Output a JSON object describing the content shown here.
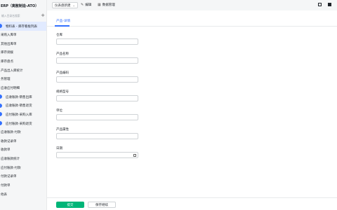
{
  "app": {
    "title": "ERP（离散制造-ATO）"
  },
  "search": {
    "placeholder": "输入目录名搜索"
  },
  "sidebar": {
    "items": [
      {
        "label": "物料表 - 库存看板列表",
        "level": 1,
        "active": true,
        "dot": true
      },
      {
        "label": "采购入库单",
        "level": 0
      },
      {
        "label": "其他出库单",
        "level": 0
      },
      {
        "label": "库存调拨",
        "level": 0
      },
      {
        "label": "库存盘点",
        "level": 0
      },
      {
        "label": "产品出入库统计",
        "level": 0
      },
      {
        "label": "务管理",
        "level": 0
      },
      {
        "label": "应收应付明细",
        "level": 0
      },
      {
        "label": "应收账款-销售出库",
        "level": 1,
        "dot": true
      },
      {
        "label": "应收账款-销售退货",
        "level": 1,
        "dot": true
      },
      {
        "label": "应付账款-采购入库",
        "level": 1,
        "dot": true
      },
      {
        "label": "应付账款-采购退货",
        "level": 1,
        "dot": true
      },
      {
        "label": "应收账款-付款",
        "level": 0
      },
      {
        "label": "收款记录单",
        "level": 0
      },
      {
        "label": "收款单",
        "level": 0
      },
      {
        "label": "应收账款统计",
        "level": 0
      },
      {
        "label": "应付账款-付款",
        "level": 0
      },
      {
        "label": "付款记录单",
        "level": 0
      },
      {
        "label": "付款单",
        "level": 0
      },
      {
        "label": "他表",
        "level": 0
      }
    ]
  },
  "topbar": {
    "select_label": "仪表盘新建",
    "edit_label": "编辑",
    "data_manage_label": "数据管理"
  },
  "main": {
    "tab_label": "产品-详情",
    "fields": [
      {
        "label": "仓库",
        "value": ""
      },
      {
        "label": "产品名称",
        "value": ""
      },
      {
        "label": "产品编码",
        "value": ""
      },
      {
        "label": "规格型号",
        "value": ""
      },
      {
        "label": "单位",
        "value": ""
      },
      {
        "label": "产品属性",
        "value": ""
      },
      {
        "label": "日期",
        "value": "",
        "calendar": true
      }
    ],
    "submit_label": "提交",
    "save_continue_label": "保存继续"
  },
  "colors": {
    "accent": "#3370ff",
    "submit": "#00b578",
    "active_bg": "#e1eaff"
  }
}
